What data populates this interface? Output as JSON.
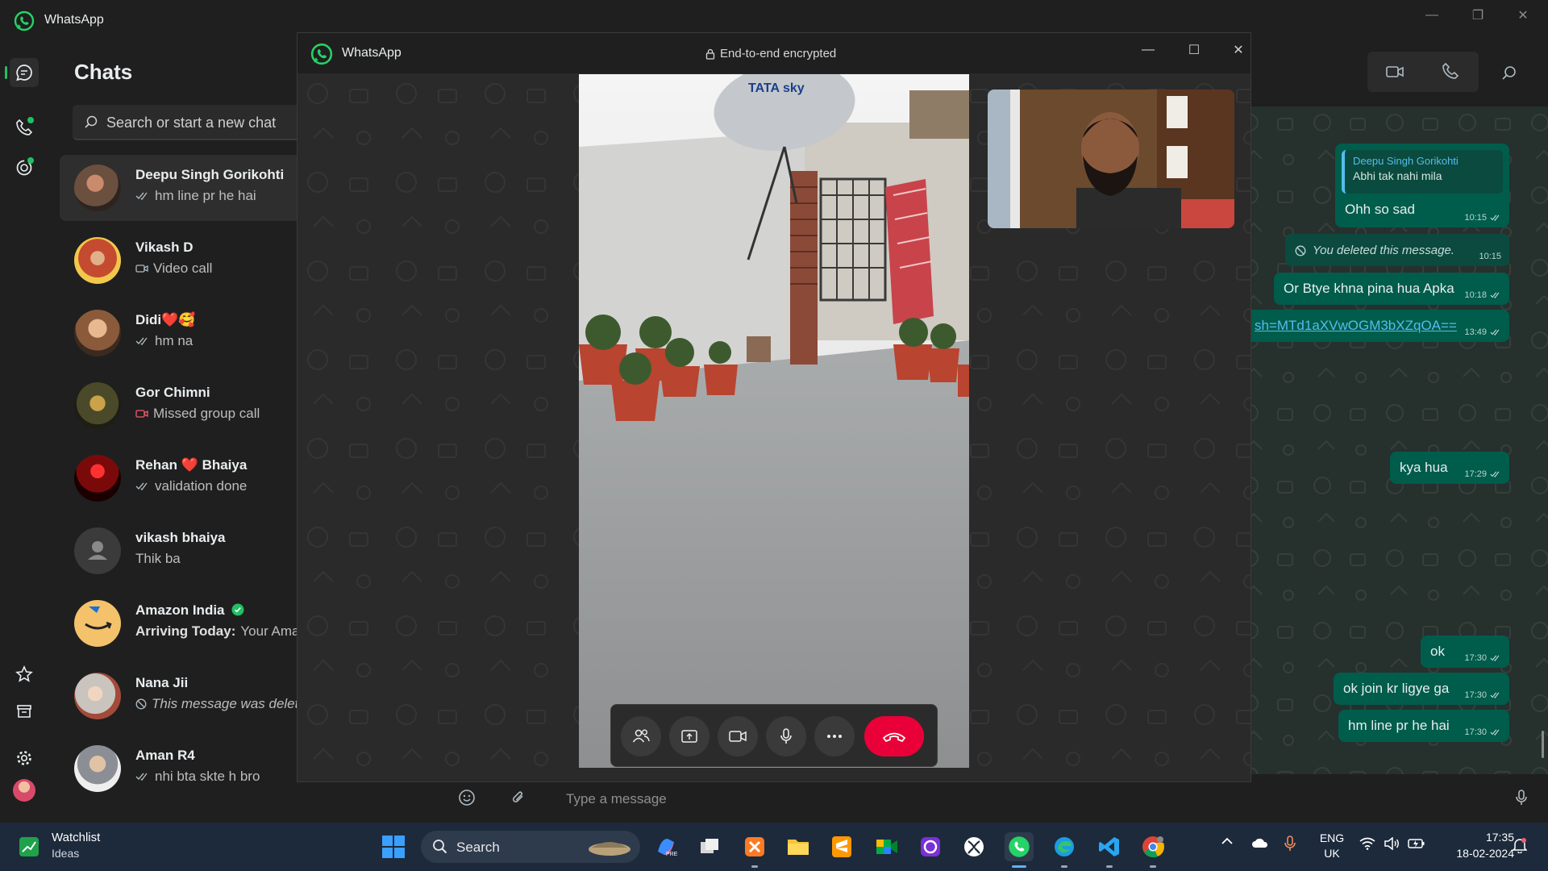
{
  "app": {
    "title": "WhatsApp"
  },
  "chats": {
    "heading": "Chats",
    "search_placeholder": "Search or start a new chat",
    "items": [
      {
        "name": "Deepu Singh Gorikohti",
        "preview": "hm line pr he hai",
        "icon": "double-tick-icon",
        "avatar_color": "#6b4f3f"
      },
      {
        "name": "Vikash D",
        "preview": "Video call",
        "icon": "video-icon",
        "avatar_color": "#a23b2a"
      },
      {
        "name": "Didi❤️🥰",
        "preview": "hm na",
        "icon": "double-tick-icon",
        "avatar_color": "#8a5a3b"
      },
      {
        "name": "Gor Chimni",
        "preview": "Missed group call",
        "icon": "missed-video-icon",
        "avatar_color": "#4a4a2a"
      },
      {
        "name": "Rehan ❤️ Bhaiya",
        "preview": "validation done",
        "icon": "double-tick-icon",
        "avatar_color": "#7a0a0a"
      },
      {
        "name": "vikash bhaiya",
        "preview": "Thik ba",
        "icon": "",
        "avatar_color": "#3b3b3b"
      },
      {
        "name": "Amazon India",
        "preview_bold": "Arriving Today:",
        "preview": "Your Amazo",
        "icon": "",
        "avatar_color": "#f3c26b",
        "verified": true
      },
      {
        "name": "Nana Jii",
        "preview": "This message was deleted",
        "icon": "deleted-icon",
        "avatar_color": "#c9c4bd"
      },
      {
        "name": "Aman R4",
        "preview": "nhi bta skte h bro",
        "icon": "double-tick-icon",
        "avatar_color": "#8b8f95"
      }
    ]
  },
  "conversation": {
    "quoted_author": "Deepu Singh Gorikohti",
    "quoted_text": "Abhi tak nahi mila",
    "messages": [
      {
        "text": "Ohh so sad",
        "time": "10:15"
      },
      {
        "text": "You deleted this message.",
        "time": "10:15",
        "deleted": true
      },
      {
        "text": "Or Btye khna pina hua Apka",
        "time": "10:18"
      },
      {
        "text": "sh=MTd1aXVwOGM3bXZqOA==",
        "time": "13:49",
        "link": true
      },
      {
        "text": "kya hua",
        "time": "17:29"
      },
      {
        "text": "ok",
        "time": "17:30"
      },
      {
        "text": "ok join kr ligye ga",
        "time": "17:30"
      },
      {
        "text": "hm line pr he hai",
        "time": "17:30"
      }
    ],
    "composer_placeholder": "Type a message"
  },
  "call": {
    "title": "WhatsApp",
    "encryption": "End-to-end encrypted",
    "controls": [
      "participants-icon",
      "share-screen-icon",
      "camera-icon",
      "microphone-icon",
      "more-icon",
      "end-call-icon"
    ],
    "end_call_color": "#ea0038"
  },
  "taskbar": {
    "weather_title": "Watchlist",
    "weather_sub": "Ideas",
    "search_label": "Search",
    "language": "ENG",
    "region": "UK",
    "time": "17:35",
    "date": "18-02-2024"
  },
  "colors": {
    "accent": "#21c063",
    "bubble": "#005c4b",
    "end_call": "#ea0038"
  }
}
